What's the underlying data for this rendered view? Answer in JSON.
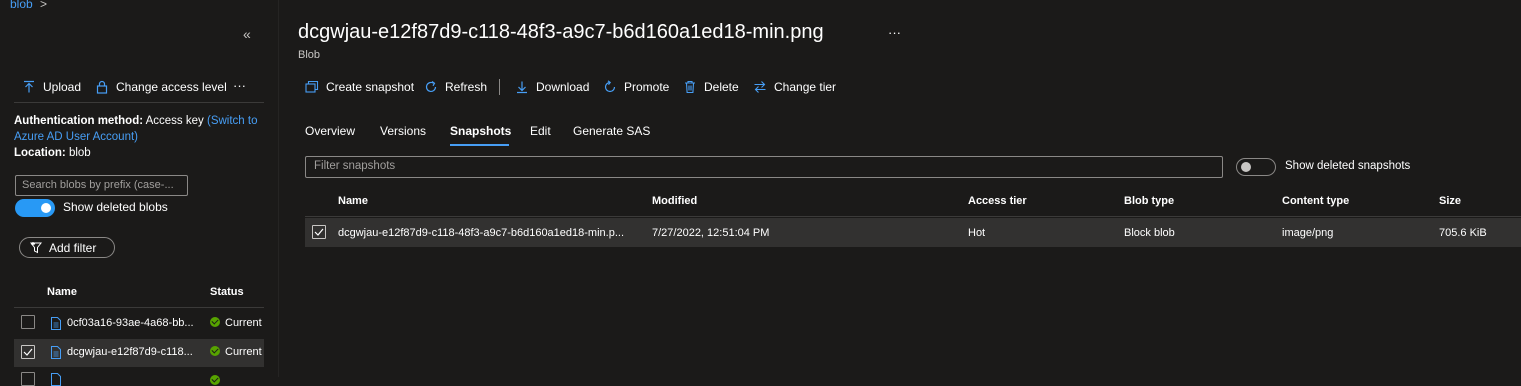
{
  "breadcrumb": {
    "label": "blob",
    "separator": ">"
  },
  "left": {
    "collapse_icon": "«",
    "toolbar": {
      "upload_label": "Upload",
      "change_access_label": "Change access level",
      "more": "···"
    },
    "auth": {
      "label": "Authentication method:",
      "value": "Access key",
      "switch_link_part1": "(Switch to",
      "switch_link_part2": "Azure AD User Account)"
    },
    "location": {
      "label": "Location:",
      "value": "blob"
    },
    "search": {
      "placeholder": "Search blobs by prefix (case-..."
    },
    "show_deleted": {
      "label": "Show deleted blobs",
      "on": true
    },
    "add_filter_label": "Add filter",
    "table": {
      "headers": {
        "name": "Name",
        "status": "Status"
      },
      "rows": [
        {
          "name": "0cf03a16-93ae-4a68-bb...",
          "status": "Current",
          "checked": false
        },
        {
          "name": "dcgwjau-e12f87d9-c118...",
          "status": "Current",
          "checked": true
        }
      ]
    }
  },
  "main": {
    "title": "dcgwjau-e12f87d9-c118-48f3-a9c7-b6d160a1ed18-min.png",
    "title_more": "···",
    "subtitle": "Blob",
    "toolbar": {
      "create_snapshot": "Create snapshot",
      "refresh": "Refresh",
      "download": "Download",
      "promote": "Promote",
      "delete": "Delete",
      "change_tier": "Change tier"
    },
    "tabs": [
      "Overview",
      "Versions",
      "Snapshots",
      "Edit",
      "Generate SAS"
    ],
    "active_tab": "Snapshots",
    "filter": {
      "placeholder": "Filter snapshots"
    },
    "show_deleted_snapshots": {
      "label": "Show deleted snapshots",
      "on": false
    },
    "table": {
      "headers": {
        "name": "Name",
        "modified": "Modified",
        "access_tier": "Access tier",
        "blob_type": "Blob type",
        "content_type": "Content type",
        "size": "Size"
      },
      "rows": [
        {
          "name": "dcgwjau-e12f87d9-c118-48f3-a9c7-b6d160a1ed18-min.p...",
          "modified": "7/27/2022, 12:51:04 PM",
          "access_tier": "Hot",
          "blob_type": "Block blob",
          "content_type": "image/png",
          "size": "705.6 KiB",
          "checked": true
        }
      ]
    }
  },
  "colors": {
    "background": "#1b1a19",
    "accent": "#479ef5",
    "toggle_on": "#2899f5",
    "status_ok": "#57a300",
    "row_highlight": "#323130"
  }
}
